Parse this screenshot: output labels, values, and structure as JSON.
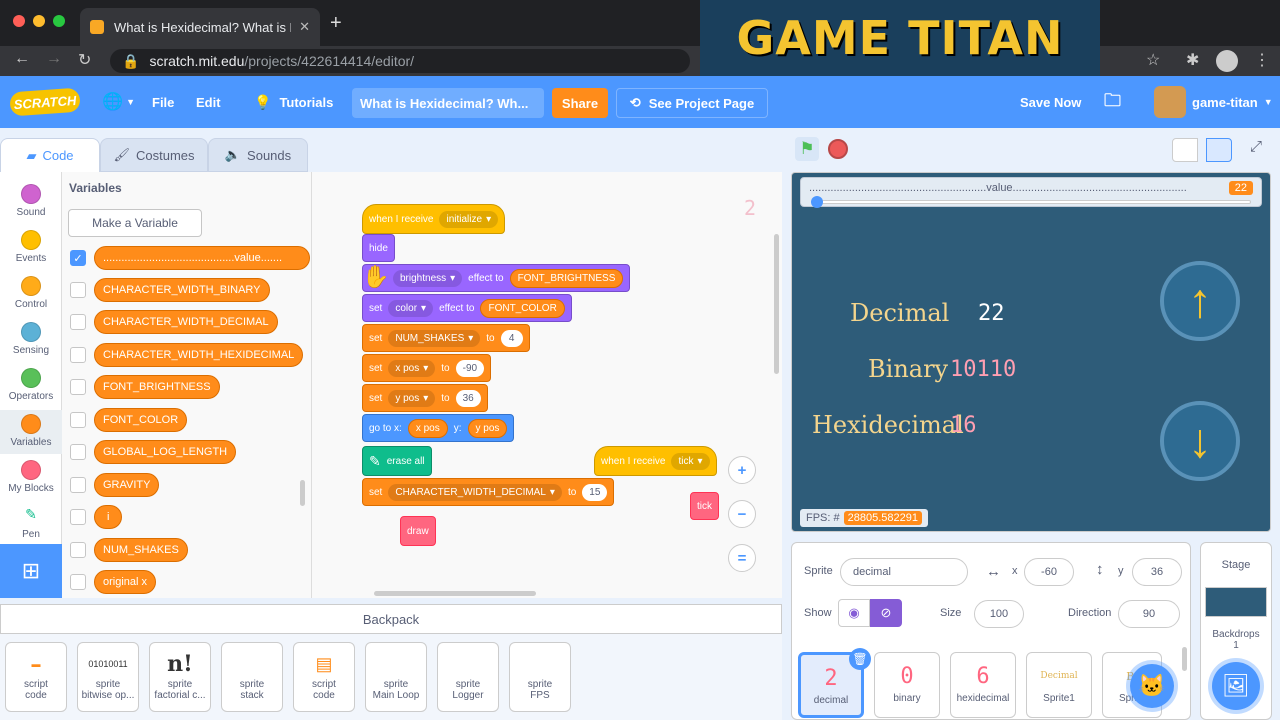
{
  "browser": {
    "tab_title": "What is Hexidecimal? What is B",
    "tab_close": "✕",
    "new_tab": "+",
    "url_host": "scratch.mit.edu",
    "url_path": "/projects/422614414/editor/"
  },
  "overlay": {
    "banner_text": "GAME TITAN"
  },
  "menubar": {
    "logo": "SCRATCH",
    "file": "File",
    "edit": "Edit",
    "tutorials": "Tutorials",
    "project_title": "What is Hexidecimal?  Wh...",
    "share": "Share",
    "see_project": "See Project Page",
    "save_now": "Save Now",
    "username": "game-titan"
  },
  "editor_tabs": {
    "code": "Code",
    "costumes": "Costumes",
    "sounds": "Sounds"
  },
  "categories": [
    {
      "label": "Sound",
      "color": "#cf63cf"
    },
    {
      "label": "Events",
      "color": "#ffbf00"
    },
    {
      "label": "Control",
      "color": "#ffab19"
    },
    {
      "label": "Sensing",
      "color": "#5cb1d6"
    },
    {
      "label": "Operators",
      "color": "#59c059"
    },
    {
      "label": "Variables",
      "color": "#ff8c1a"
    },
    {
      "label": "My Blocks",
      "color": "#ff6680"
    },
    {
      "label": "Pen",
      "color": "#0fbd8c"
    }
  ],
  "palette": {
    "title": "Variables",
    "make_variable": "Make a Variable",
    "variables": [
      "...........................................value.......",
      "CHARACTER_WIDTH_BINARY",
      "CHARACTER_WIDTH_DECIMAL",
      "CHARACTER_WIDTH_HEXIDECIMAL",
      "FONT_BRIGHTNESS",
      "FONT_COLOR",
      "GLOBAL_LOG_LENGTH",
      "GRAVITY",
      "i",
      "NUM_SHAKES",
      "original x"
    ]
  },
  "script": {
    "corner_number": "2",
    "b1": {
      "t1": "when I receive",
      "d": "initialize"
    },
    "b2": {
      "t1": "hide"
    },
    "b3": {
      "d": "brightness",
      "t2": "effect to",
      "v": "FONT_BRIGHTNESS"
    },
    "b4": {
      "t1": "set",
      "d": "color",
      "t2": "effect to",
      "v": "FONT_COLOR"
    },
    "b5": {
      "t1": "set",
      "d": "NUM_SHAKES",
      "t2": "to",
      "n": "4"
    },
    "b6": {
      "t1": "set",
      "d": "x pos",
      "t2": "to",
      "n": "-90"
    },
    "b7": {
      "t1": "set",
      "d": "y pos",
      "t2": "to",
      "n": "36"
    },
    "b8": {
      "t1": "go to x:",
      "v1": "x pos",
      "t2": "y:",
      "v2": "y pos"
    },
    "b9": {
      "t1": "erase all"
    },
    "b10": {
      "t1": "set",
      "d": "CHARACTER_WIDTH_DECIMAL",
      "t2": "to",
      "n": "15"
    },
    "b11": {
      "t1": "draw"
    },
    "b12": {
      "t1": "when I receive",
      "d": "tick"
    },
    "b13": {
      "t1": "tick"
    },
    "zoom_in": "+",
    "zoom_out": "−",
    "zoom_reset": "="
  },
  "backpack": {
    "title": "Backpack",
    "items": [
      {
        "kind": "script",
        "name": "code",
        "thumb": "▬"
      },
      {
        "kind": "sprite",
        "name": "bitwise op...",
        "thumb": "01010011"
      },
      {
        "kind": "sprite",
        "name": "factorial c...",
        "thumb": "n!"
      },
      {
        "kind": "sprite",
        "name": "stack",
        "thumb": ""
      },
      {
        "kind": "script",
        "name": "code",
        "thumb": "▤"
      },
      {
        "kind": "sprite",
        "name": "Main Loop",
        "thumb": ""
      },
      {
        "kind": "sprite",
        "name": "Logger",
        "thumb": ""
      },
      {
        "kind": "sprite",
        "name": "FPS",
        "thumb": ""
      }
    ]
  },
  "stage": {
    "monitor_label": "..........................................................value.........................................................",
    "monitor_value": "22",
    "slider_fraction": 0.0,
    "decimal_label": "Decimal",
    "decimal_value": "22",
    "binary_label": "Binary",
    "binary_value": "10110",
    "hex_label": "Hexidecimal",
    "hex_value": "16",
    "up_arrow": "↑",
    "down_arrow": "↓",
    "fps_label": "FPS: #",
    "fps_value": "28805.582291"
  },
  "sprite_info": {
    "sprite_label": "Sprite",
    "sprite_name": "decimal",
    "x_label": "x",
    "x_value": "-60",
    "y_label": "y",
    "y_value": "36",
    "show_label": "Show",
    "size_label": "Size",
    "size_value": "100",
    "direction_label": "Direction",
    "direction_value": "90"
  },
  "sprites": [
    {
      "name": "decimal",
      "thumb": "2"
    },
    {
      "name": "binary",
      "thumb": "0"
    },
    {
      "name": "hexidecimal",
      "thumb": "6"
    },
    {
      "name": "Sprite1",
      "thumb": "Decimal"
    },
    {
      "name": "Sprite",
      "thumb": "Bi"
    }
  ],
  "stage_panel": {
    "title": "Stage",
    "backdrops_label": "Backdrops",
    "backdrops_count": "1"
  }
}
